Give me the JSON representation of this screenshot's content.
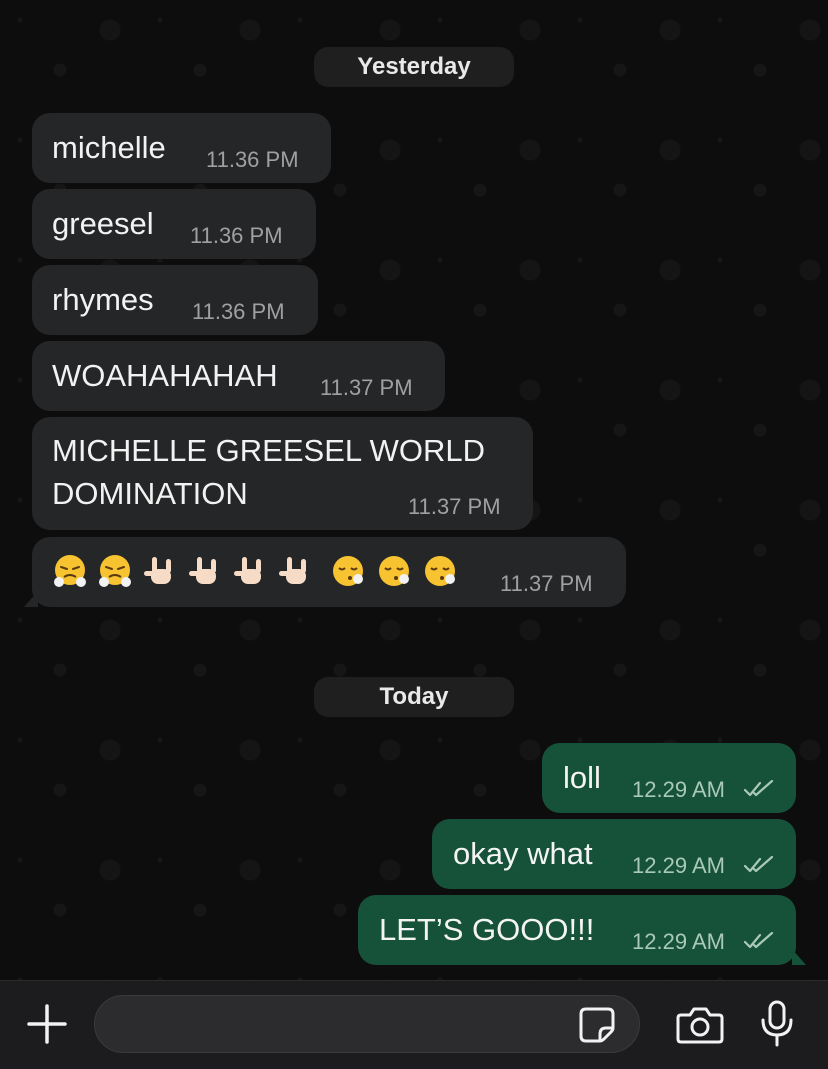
{
  "chat": {
    "separators": {
      "yesterday": "Yesterday",
      "today": "Today"
    },
    "messages": [
      {
        "direction": "in",
        "text": "michelle",
        "time": "11.36 PM"
      },
      {
        "direction": "in",
        "text": "greesel",
        "time": "11.36 PM"
      },
      {
        "direction": "in",
        "text": "rhymes",
        "time": "11.36 PM"
      },
      {
        "direction": "in",
        "text": "WOAHAHAHAH",
        "time": "11.37 PM"
      },
      {
        "direction": "in",
        "text_line1": "MICHELLE GREESEL WORLD",
        "text_line2": "DOMINATION",
        "time": "11.37 PM"
      },
      {
        "direction": "in",
        "emojis": [
          "face-with-steam-from-nose",
          "face-with-steam-from-nose",
          "sign-of-the-horns",
          "sign-of-the-horns",
          "sign-of-the-horns",
          "sign-of-the-horns",
          "face-exhaling",
          "face-exhaling",
          "face-exhaling"
        ],
        "time": "11.37 PM"
      },
      {
        "direction": "out",
        "text": "loll",
        "time": "12.29 AM",
        "status": "read"
      },
      {
        "direction": "out",
        "text": "okay what",
        "time": "12.29 AM",
        "status": "read"
      },
      {
        "direction": "out",
        "text": "LET’S GOOO!!!",
        "time": "12.29 AM",
        "status": "read"
      }
    ]
  },
  "input_bar": {
    "message_value": "",
    "icons": [
      "plus-icon",
      "sticker-icon",
      "camera-icon",
      "microphone-icon"
    ]
  },
  "colors": {
    "incoming_bubble": "#252627",
    "outgoing_bubble": "#16513a",
    "read_ticks": "#a9c9b9"
  }
}
